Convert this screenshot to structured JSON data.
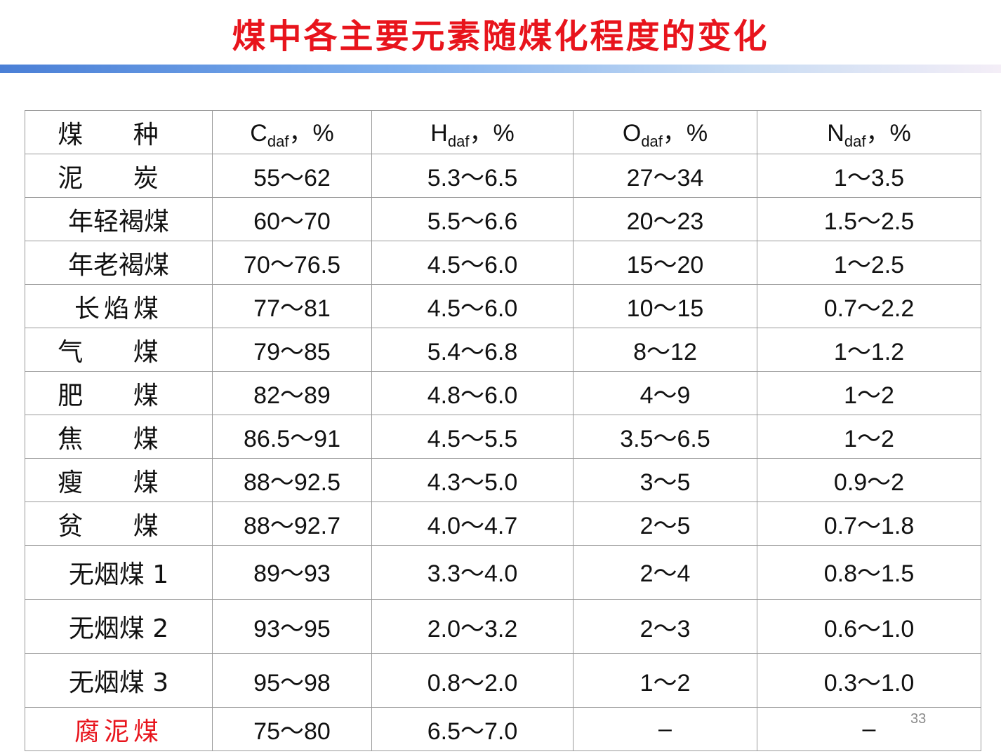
{
  "title": "煤中各主要元素随煤化程度的变化",
  "page_number": "33",
  "colors": {
    "title": "#e8141c",
    "highlight_row": "#e8141c"
  },
  "table": {
    "header": {
      "coal_type": "煤 种",
      "c": {
        "base": "C",
        "sub": "daf",
        "suffix": "，%"
      },
      "h": {
        "base": "H",
        "sub": "daf",
        "suffix": "，%"
      },
      "o": {
        "base": "O",
        "sub": "daf",
        "suffix": "，%"
      },
      "n": {
        "base": "N",
        "sub": "daf",
        "suffix": "，%"
      }
    },
    "rows": [
      {
        "name": "泥 炭",
        "c": "55～62",
        "h": "5.3～6.5",
        "o": "27～34",
        "n": "1～3.5"
      },
      {
        "name": "年轻褐煤",
        "c": "60～70",
        "h": "5.5～6.6",
        "o": "20～23",
        "n": "1.5～2.5"
      },
      {
        "name": "年老褐煤",
        "c": "70～76.5",
        "h": "4.5～6.0",
        "o": "15～20",
        "n": "1～2.5"
      },
      {
        "name": "长焰煤",
        "c": "77～81",
        "h": "4.5～6.0",
        "o": "10～15",
        "n": "0.7～2.2"
      },
      {
        "name": "气 煤",
        "c": "79～85",
        "h": "5.4～6.8",
        "o": "8～12",
        "n": "1～1.2"
      },
      {
        "name": "肥 煤",
        "c": "82～89",
        "h": "4.8～6.0",
        "o": "4～9",
        "n": "1～2"
      },
      {
        "name": "焦 煤",
        "c": "86.5～91",
        "h": "4.5～5.5",
        "o": "3.5～6.5",
        "n": "1～2"
      },
      {
        "name": "瘦 煤",
        "c": "88～92.5",
        "h": "4.3～5.0",
        "o": "3～5",
        "n": "0.9～2"
      },
      {
        "name": "贫 煤",
        "c": "88～92.7",
        "h": "4.0～4.7",
        "o": "2～5",
        "n": "0.7～1.8"
      },
      {
        "name": "无烟煤 1",
        "c": "89～93",
        "h": "3.3～4.0",
        "o": "2～4",
        "n": "0.8～1.5"
      },
      {
        "name": "无烟煤 2",
        "c": "93～95",
        "h": "2.0～3.2",
        "o": "2～3",
        "n": "0.6～1.0"
      },
      {
        "name": "无烟煤 3",
        "c": "95～98",
        "h": "0.8～2.0",
        "o": "1～2",
        "n": "0.3～1.0"
      },
      {
        "name": "腐泥煤",
        "c": "75～80",
        "h": "6.5～7.0",
        "o": "–",
        "n": "–"
      }
    ]
  }
}
